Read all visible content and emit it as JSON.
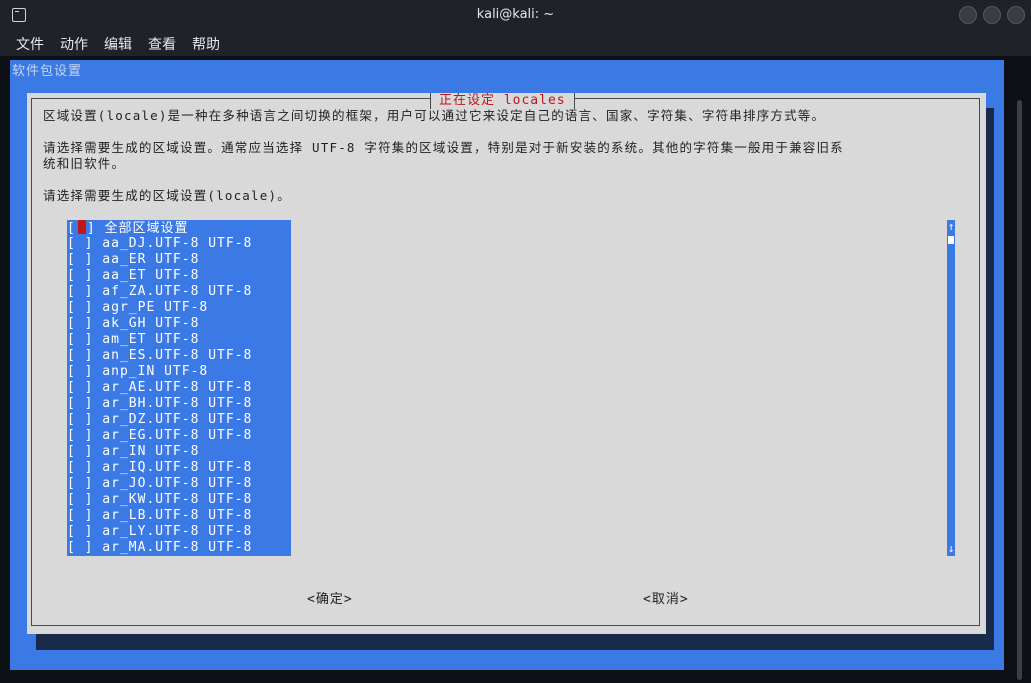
{
  "window": {
    "title": "kali@kali: ~"
  },
  "menu": {
    "items": [
      "文件",
      "动作",
      "编辑",
      "查看",
      "帮助"
    ]
  },
  "terminal": {
    "background_title": "软件包设置"
  },
  "dialog": {
    "title": "正在设定 locales",
    "paragraph1": "区域设置(locale)是一种在多种语言之间切换的框架，用户可以通过它来设定自己的语言、国家、字符集、字符串排序方式等。",
    "paragraph2_line1": "请选择需要生成的区域设置。通常应当选择 UTF-8 字符集的区域设置，特别是对于新安装的系统。其他的字符集一般用于兼容旧系",
    "paragraph2_line2": "统和旧软件。",
    "prompt": "请选择需要生成的区域设置(locale)。",
    "checkbox_prefix": "[ ]",
    "locales": [
      "全部区域设置",
      "aa_DJ.UTF-8 UTF-8",
      "aa_ER UTF-8",
      "aa_ET UTF-8",
      "af_ZA.UTF-8 UTF-8",
      "agr_PE UTF-8",
      "ak_GH UTF-8",
      "am_ET UTF-8",
      "an_ES.UTF-8 UTF-8",
      "anp_IN UTF-8",
      "ar_AE.UTF-8 UTF-8",
      "ar_BH.UTF-8 UTF-8",
      "ar_DZ.UTF-8 UTF-8",
      "ar_EG.UTF-8 UTF-8",
      "ar_IN UTF-8",
      "ar_IQ.UTF-8 UTF-8",
      "ar_JO.UTF-8 UTF-8",
      "ar_KW.UTF-8 UTF-8",
      "ar_LB.UTF-8 UTF-8",
      "ar_LY.UTF-8 UTF-8",
      "ar_MA.UTF-8 UTF-8"
    ],
    "ok_button": "<确定>",
    "cancel_button": "<取消>",
    "scroll_up": "↑",
    "scroll_down": "↓"
  },
  "colors": {
    "accent": "#3b79e4",
    "title_red": "#c01818",
    "dialog_bg": "#d9d9d9"
  }
}
